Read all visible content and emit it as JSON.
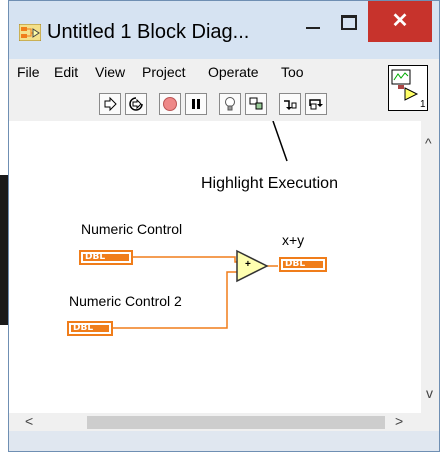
{
  "window": {
    "title": "Untitled 1 Block Diag...",
    "close_glyph": "✕"
  },
  "menu": {
    "items": [
      "File",
      "Edit",
      "View",
      "Project",
      "Operate",
      "Too"
    ]
  },
  "toolbar": {
    "buttons": [
      "run-icon",
      "run-continuously-icon",
      "abort-icon",
      "pause-icon",
      "highlight-execution-icon",
      "retain-wire-values-icon",
      "step-into-icon",
      "step-over-icon"
    ]
  },
  "vi_icon": {
    "number": "1"
  },
  "annotation": {
    "text": "Highlight Execution"
  },
  "diagram": {
    "control1": {
      "label": "Numeric Control",
      "type": "DBL"
    },
    "control2": {
      "label": "Numeric Control 2",
      "type": "DBL"
    },
    "add_node": {
      "symbol": "+"
    },
    "indicator": {
      "label": "x+y",
      "type": "DBL"
    },
    "wire_color": "#f07d1a"
  },
  "scroll": {
    "up": "^",
    "down": "v",
    "left": "<",
    "right": ">"
  }
}
